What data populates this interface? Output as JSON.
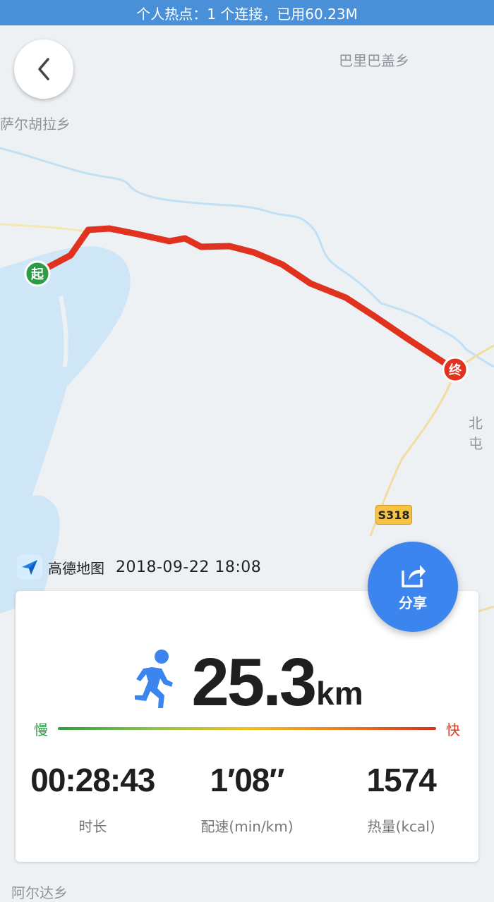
{
  "status_bar": {
    "text": "个人热点：1 个连接，已用60.23M"
  },
  "map": {
    "labels": {
      "top_town": "巴里巴盖乡",
      "left_town": "萨尔胡拉乡",
      "right_town": "北屯",
      "bottom_town": "阿尔达乡"
    },
    "start_marker": "起",
    "end_marker": "终",
    "road_badge": "S318",
    "route_color": "#e0321e"
  },
  "brand": {
    "name": "高德地图",
    "date": "2018-09-22  18:08"
  },
  "share": {
    "label": "分享",
    "icon": "share-icon"
  },
  "summary": {
    "activity_icon": "runner-icon",
    "distance": "25.3",
    "distance_unit": "km",
    "speed_legend": {
      "slow": "慢",
      "fast": "快"
    },
    "stats": [
      {
        "value": "00:28:43",
        "label": "时长"
      },
      {
        "value": "1′08″",
        "label": "配速(min/km)"
      },
      {
        "value": "1574",
        "label": "热量(kcal)"
      }
    ]
  },
  "colors": {
    "accent": "#3c85ee",
    "water": "#cfe6f7",
    "start": "#2e9b47",
    "end": "#e0321e"
  }
}
